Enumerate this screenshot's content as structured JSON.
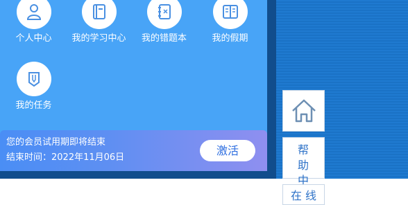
{
  "colors": {
    "panel": "#48a4f7",
    "frame": "#114d8c",
    "icon": "#4a90e2",
    "accent_text": "#2f73c8"
  },
  "tiles": [
    {
      "label": "个人中心",
      "icon": "person-icon"
    },
    {
      "label": "我的学习中心",
      "icon": "book-icon"
    },
    {
      "label": "我的错题本",
      "icon": "wrong-notebook-icon"
    },
    {
      "label": "我的假期",
      "icon": "open-book-icon"
    },
    {
      "label": "我的任务",
      "icon": "pencil-badge-icon"
    }
  ],
  "banner": {
    "message": "您的会员试用期即将结束",
    "end_time": "结束时间：2022年11月06日",
    "activate_label": "激活"
  },
  "side": {
    "home_icon": "home-icon",
    "help_label": "帮助中心",
    "online_label": "在线"
  }
}
